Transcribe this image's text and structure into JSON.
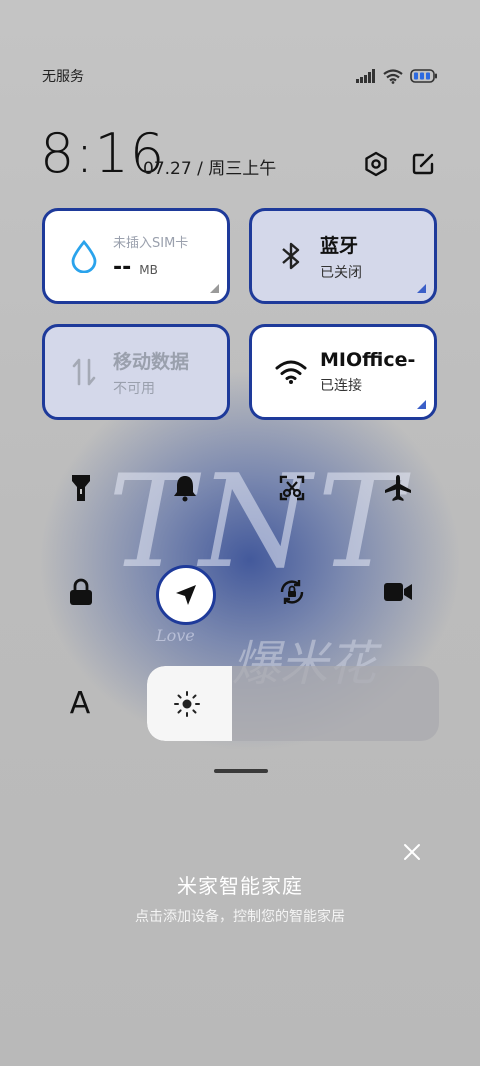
{
  "status_bar": {
    "carrier": "无服务",
    "icons": [
      "signal-icon",
      "wifi-icon",
      "battery-icon"
    ]
  },
  "header": {
    "time": "8:16",
    "date": "07.27 / 周三上午",
    "settings_icon": "gear-icon",
    "edit_icon": "edit-icon"
  },
  "tiles": [
    {
      "name": "data-usage",
      "title": "--",
      "unit": "MB",
      "caption": "未插入SIM卡",
      "icon": "water-drop-icon",
      "state": "white"
    },
    {
      "name": "bluetooth",
      "title": "蓝牙",
      "sub": "已关闭",
      "icon": "bluetooth-icon",
      "state": "blue"
    },
    {
      "name": "mobile-data",
      "title": "移动数据",
      "sub": "不可用",
      "icon": "data-arrows-icon",
      "state": "disabled"
    },
    {
      "name": "wifi",
      "title": "MIOffice-",
      "sub": "已连接",
      "icon": "wifi-icon",
      "state": "white"
    }
  ],
  "quick_toggles": [
    {
      "name": "flashlight",
      "icon": "flashlight-icon"
    },
    {
      "name": "bell",
      "icon": "bell-icon"
    },
    {
      "name": "screenshot",
      "icon": "screenshot-icon"
    },
    {
      "name": "airplane",
      "icon": "airplane-icon"
    },
    {
      "name": "lock",
      "icon": "lock-icon"
    },
    {
      "name": "location",
      "icon": "location-arrow-icon",
      "active": true
    },
    {
      "name": "rotation-lock",
      "icon": "rotate-lock-icon"
    },
    {
      "name": "screen-record",
      "icon": "video-camera-icon"
    }
  ],
  "font_button": {
    "label": "A"
  },
  "brightness": {
    "level": 0.29,
    "icon": "sun-icon"
  },
  "wallpaper": {
    "big": "TNT",
    "love": "Love",
    "script": "爆米花"
  },
  "mijia": {
    "title": "米家智能家庭",
    "subtitle": "点击添加设备，控制您的智能家居",
    "close_icon": "close-icon"
  },
  "colors": {
    "accent": "#1e3a9a",
    "tile_blue": "#d4d8ea",
    "link": "#3b5fc8"
  }
}
